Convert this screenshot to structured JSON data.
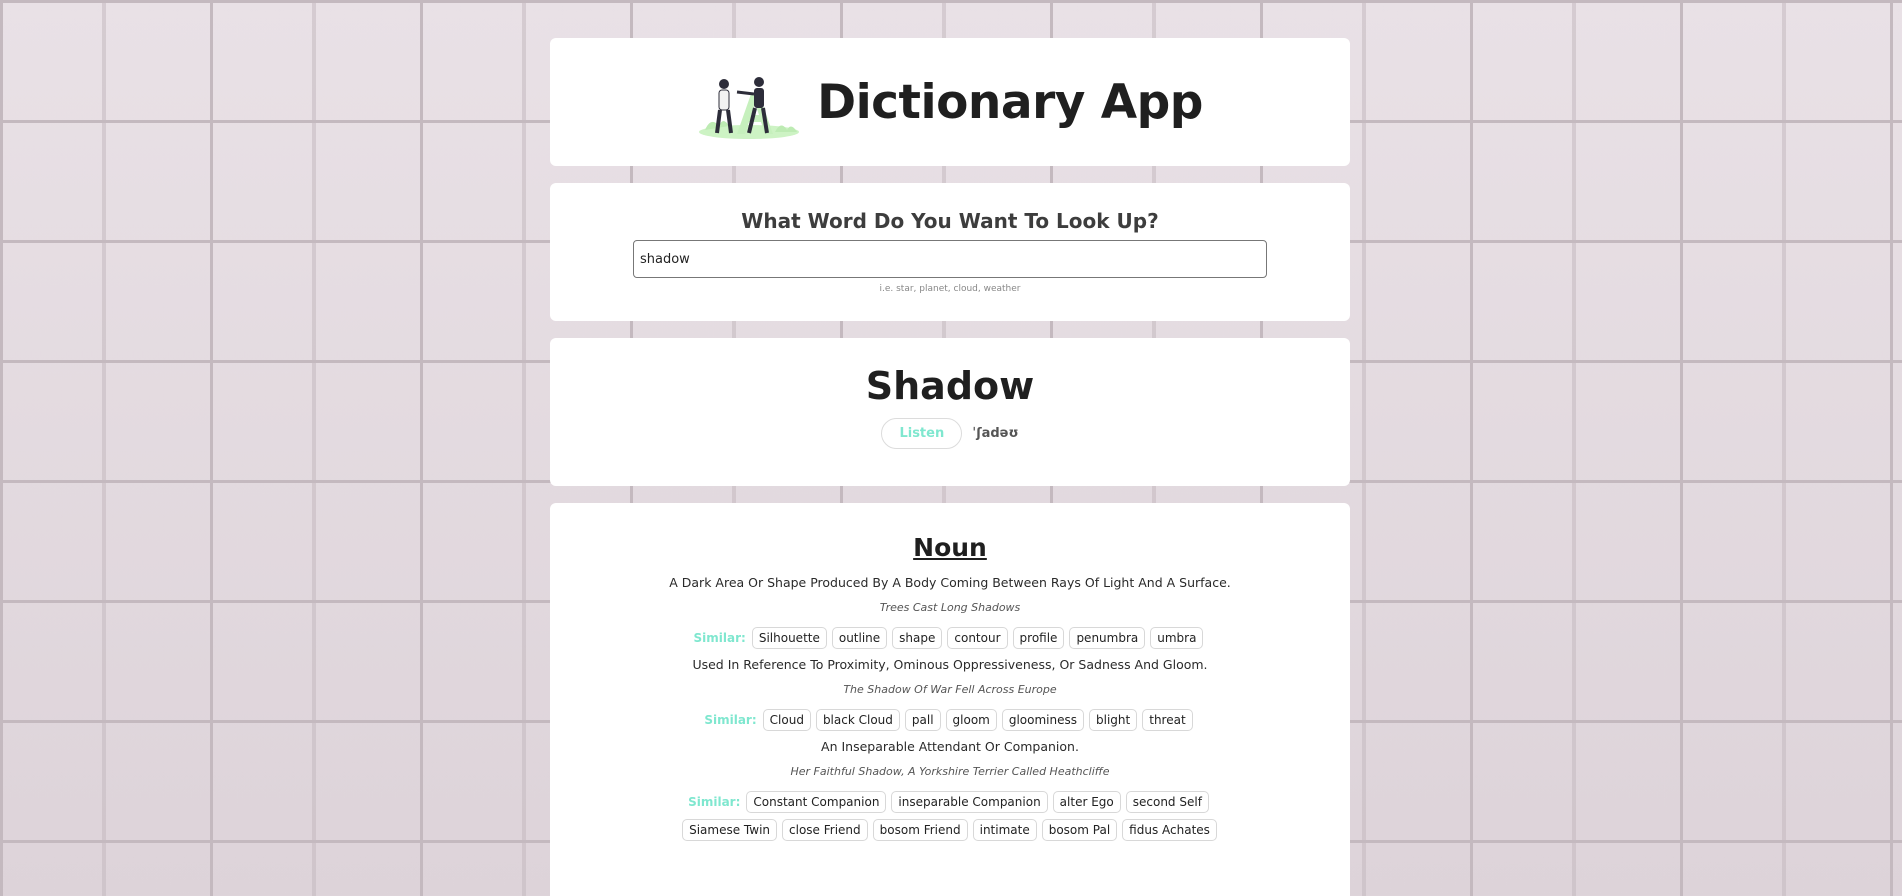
{
  "header": {
    "title": "Dictionary App",
    "logo_icon": "people-dictionary-illustration"
  },
  "search": {
    "heading": "What Word Do You Want To Look Up?",
    "value": "shadow",
    "hint": "i.e. star, planet, cloud, weather"
  },
  "word": {
    "title": "Shadow",
    "listen_label": "Listen",
    "phonetic": "ˈʃadəʊ"
  },
  "meaning": {
    "part_of_speech": "Noun",
    "similar_label": "Similar:",
    "definitions": [
      {
        "definition": "A Dark Area Or Shape Produced By A Body Coming Between Rays Of Light And A Surface.",
        "example": "Trees Cast Long Shadows",
        "similar": [
          "Silhouette",
          "outline",
          "shape",
          "contour",
          "profile",
          "penumbra",
          "umbra"
        ]
      },
      {
        "definition": "Used In Reference To Proximity, Ominous Oppressiveness, Or Sadness And Gloom.",
        "example": "The Shadow Of War Fell Across Europe",
        "similar": [
          "Cloud",
          "black Cloud",
          "pall",
          "gloom",
          "gloominess",
          "blight",
          "threat"
        ]
      },
      {
        "definition": "An Inseparable Attendant Or Companion.",
        "example": "Her Faithful Shadow, A Yorkshire Terrier Called Heathcliffe",
        "similar": [
          "Constant Companion",
          "inseparable Companion",
          "alter Ego",
          "second Self",
          "Siamese Twin",
          "close Friend",
          "bosom Friend",
          "intimate",
          "bosom Pal",
          "fidus Achates"
        ]
      }
    ]
  },
  "colors": {
    "accent": "#7fe7cf",
    "card": "#ffffff",
    "text": "#1f1f1f"
  }
}
